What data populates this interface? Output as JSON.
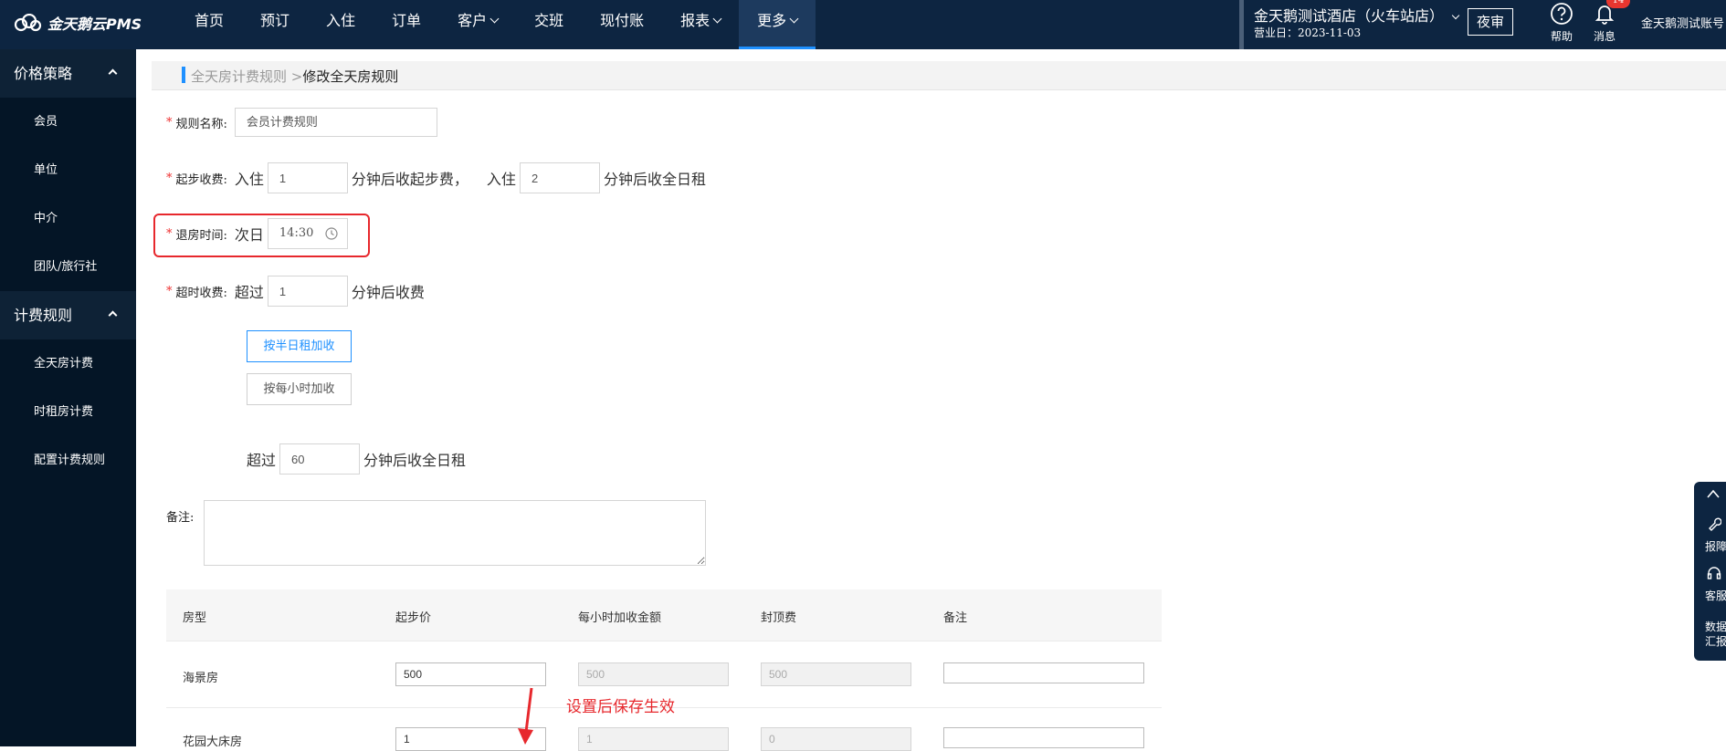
{
  "logo": {
    "text": "金天鹅云PMS"
  },
  "nav": [
    {
      "label": "首页",
      "dropdown": false,
      "active": false
    },
    {
      "label": "预订",
      "dropdown": false,
      "active": false
    },
    {
      "label": "入住",
      "dropdown": false,
      "active": false
    },
    {
      "label": "订单",
      "dropdown": false,
      "active": false
    },
    {
      "label": "客户",
      "dropdown": true,
      "active": false
    },
    {
      "label": "交班",
      "dropdown": false,
      "active": false
    },
    {
      "label": "现付账",
      "dropdown": false,
      "active": false
    },
    {
      "label": "报表",
      "dropdown": true,
      "active": false
    },
    {
      "label": "更多",
      "dropdown": true,
      "active": true
    }
  ],
  "header": {
    "hotel_name": "金天鹅测试酒店（火车站店）",
    "business_date": "营业日：2023-11-03",
    "night_audit": "夜审",
    "help": "帮助",
    "messages": "消息",
    "message_badge": "14",
    "user": "金天鹅测试账号"
  },
  "sidebar": {
    "groups": [
      {
        "title": "价格策略",
        "items": [
          "会员",
          "单位",
          "中介",
          "团队/旅行社"
        ]
      },
      {
        "title": "计费规则",
        "items": [
          "全天房计费",
          "时租房计费",
          "配置计费规则"
        ]
      }
    ]
  },
  "breadcrumb": {
    "parent": "全天房计费规则 >",
    "current": "修改全天房规则"
  },
  "form": {
    "rule_name_label": "规则名称:",
    "rule_name_value": "会员计费规则",
    "start_fee_label": "起步收费:",
    "checkin_text": "入住",
    "start_minutes": "1",
    "start_after_text": "分钟后收起步费，",
    "checkin_text2": "入住",
    "full_minutes": "2",
    "full_after_text": "分钟后收全日租",
    "checkout_label": "退房时间:",
    "next_day_text": "次日",
    "checkout_time": "14:30",
    "overtime_label": "超时收费:",
    "exceed_text": "超过",
    "overtime_minutes": "1",
    "overtime_after_text": "分钟后收费",
    "option_half_day": "按半日租加收",
    "option_hourly": "按每小时加收",
    "exceed_text2": "超过",
    "full_day_minutes": "60",
    "full_day_after_text": "分钟后收全日租",
    "notes_label": "备注:",
    "notes_value": ""
  },
  "table": {
    "headers": [
      "房型",
      "起步价",
      "每小时加收金额",
      "封顶费",
      "备注"
    ],
    "rows": [
      {
        "room_type": "海景房",
        "start_price": "500",
        "hourly": "500",
        "cap": "500",
        "note": ""
      },
      {
        "room_type": "花园大床房",
        "start_price": "1",
        "hourly": "1",
        "cap": "0",
        "note": ""
      }
    ]
  },
  "annotation": "设置后保存生效",
  "float_toolbar": {
    "item1": "报障",
    "item2": "客服",
    "item3a": "数据",
    "item3b": "汇报"
  },
  "colors": {
    "topbar": "#0d2541",
    "sidebar": "#041526",
    "accent": "#1e90ff",
    "highlight": "#e7282d"
  }
}
